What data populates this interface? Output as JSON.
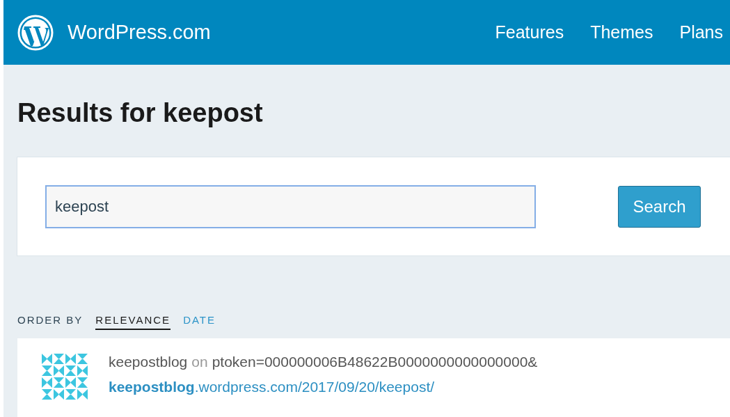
{
  "header": {
    "brand": "WordPress.com",
    "nav": [
      {
        "label": "Features"
      },
      {
        "label": "Themes"
      },
      {
        "label": "Plans"
      }
    ]
  },
  "title": "Results for keepost",
  "search": {
    "value": "keepost",
    "button": "Search"
  },
  "order": {
    "label": "ORDER BY",
    "options": [
      {
        "label": "RELEVANCE",
        "selected": true
      },
      {
        "label": "DATE",
        "selected": false
      }
    ]
  },
  "results": [
    {
      "site": "keepostblog",
      "connector": "on",
      "post_title": "ptoken=000000006B48622B0000000000000000&",
      "url": "**keepostblog**.wordpress.com/2017/09/20/keepost/"
    }
  ]
}
